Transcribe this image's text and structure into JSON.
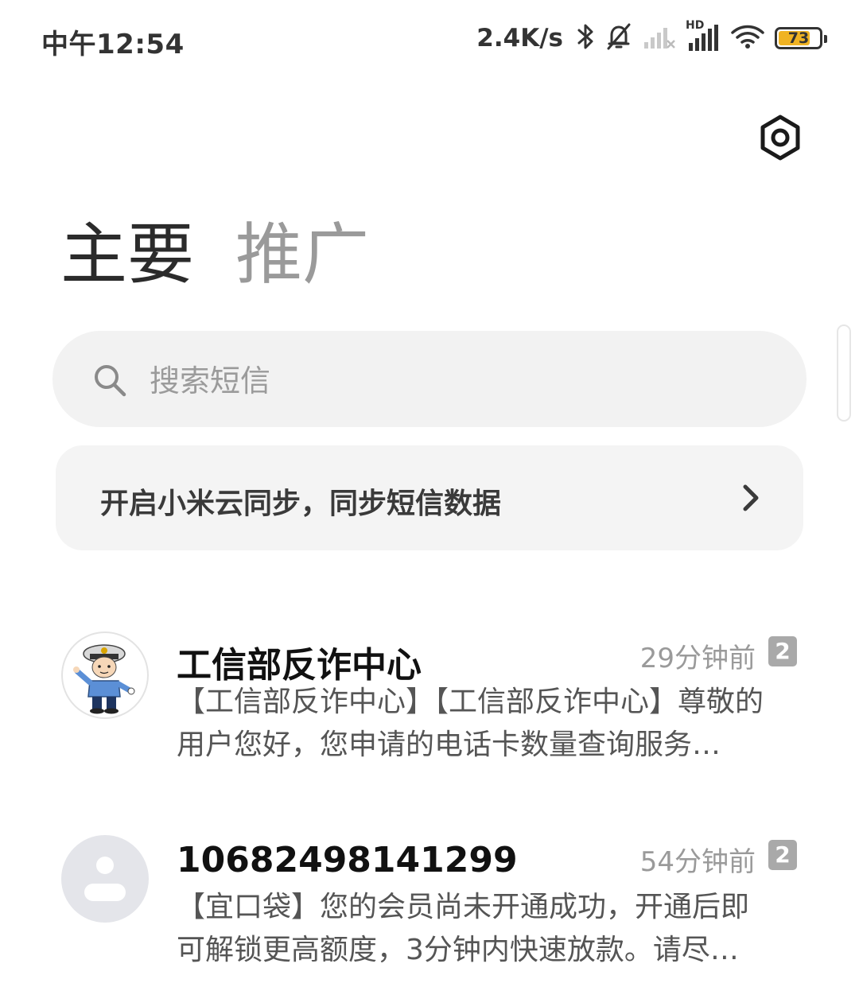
{
  "status_bar": {
    "time": "中午12:54",
    "net_speed": "2.4K/s",
    "signal_label": "HD",
    "battery_level": "73"
  },
  "tabs": [
    {
      "label": "主要",
      "active": true
    },
    {
      "label": "推广",
      "active": false
    }
  ],
  "search": {
    "placeholder": "搜索短信",
    "value": ""
  },
  "sync_banner": {
    "text": "开启小米云同步，同步短信数据"
  },
  "messages": [
    {
      "sender": "工信部反诈中心",
      "time": "29分钟前",
      "badge": "2",
      "preview_line1": "【工信部反诈中心】【工信部反诈中心】尊敬的",
      "preview_line2": "用户您好，您申请的电话卡数量查询服务…"
    },
    {
      "sender": "10682498141299",
      "time": "54分钟前",
      "badge": "2",
      "preview_line1": "【宜口袋】您的会员尚未开通成功，开通后即",
      "preview_line2": "可解锁更高额度，3分钟内快速放款。请尽…"
    }
  ],
  "colors": {
    "accent_battery": "#f0b323",
    "text_primary": "#111111",
    "text_secondary": "#9a9a9a",
    "surface": "#f2f2f2"
  },
  "icons": {
    "settings": "hexagon-settings-icon",
    "search": "search-icon",
    "sync_chevron": "chevron-right-icon",
    "bluetooth": "bluetooth-icon",
    "mute": "bell-muted-icon",
    "wifi": "wifi-icon"
  }
}
